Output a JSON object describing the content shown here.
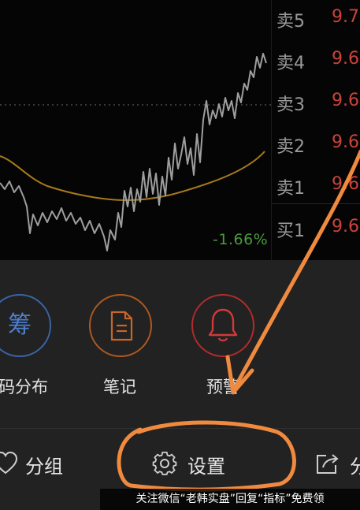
{
  "order_book": [
    {
      "label": "卖5",
      "price": "9.7"
    },
    {
      "label": "卖4",
      "price": "9.6"
    },
    {
      "label": "卖3",
      "price": "9.6"
    },
    {
      "label": "卖2",
      "price": "9.6"
    },
    {
      "label": "卖1",
      "price": "9.6"
    },
    {
      "label": "买1",
      "price": "9.6"
    }
  ],
  "chart": {
    "change_percent": "-1.66%",
    "colors": {
      "price_line": "#9e9e9e",
      "avg_line": "#a77a1c",
      "reference_line": "#6a6a6a"
    }
  },
  "sheet": {
    "actions": [
      {
        "label": "码分布",
        "glyph": "筹",
        "icon": "chip-distribution-icon",
        "color": "#3b64a6"
      },
      {
        "label": "笔记",
        "icon": "notes-icon",
        "color": "#b1591f"
      },
      {
        "label": "预警",
        "icon": "bell-icon",
        "color": "#b52b2b"
      }
    ],
    "bar": {
      "group_label": "分组",
      "settings_label": "设置",
      "share_label": "分"
    }
  },
  "annotation": {
    "color": "#f08a3e"
  },
  "caption": "关注微信“老韩实盘”回复“指标”免费领"
}
